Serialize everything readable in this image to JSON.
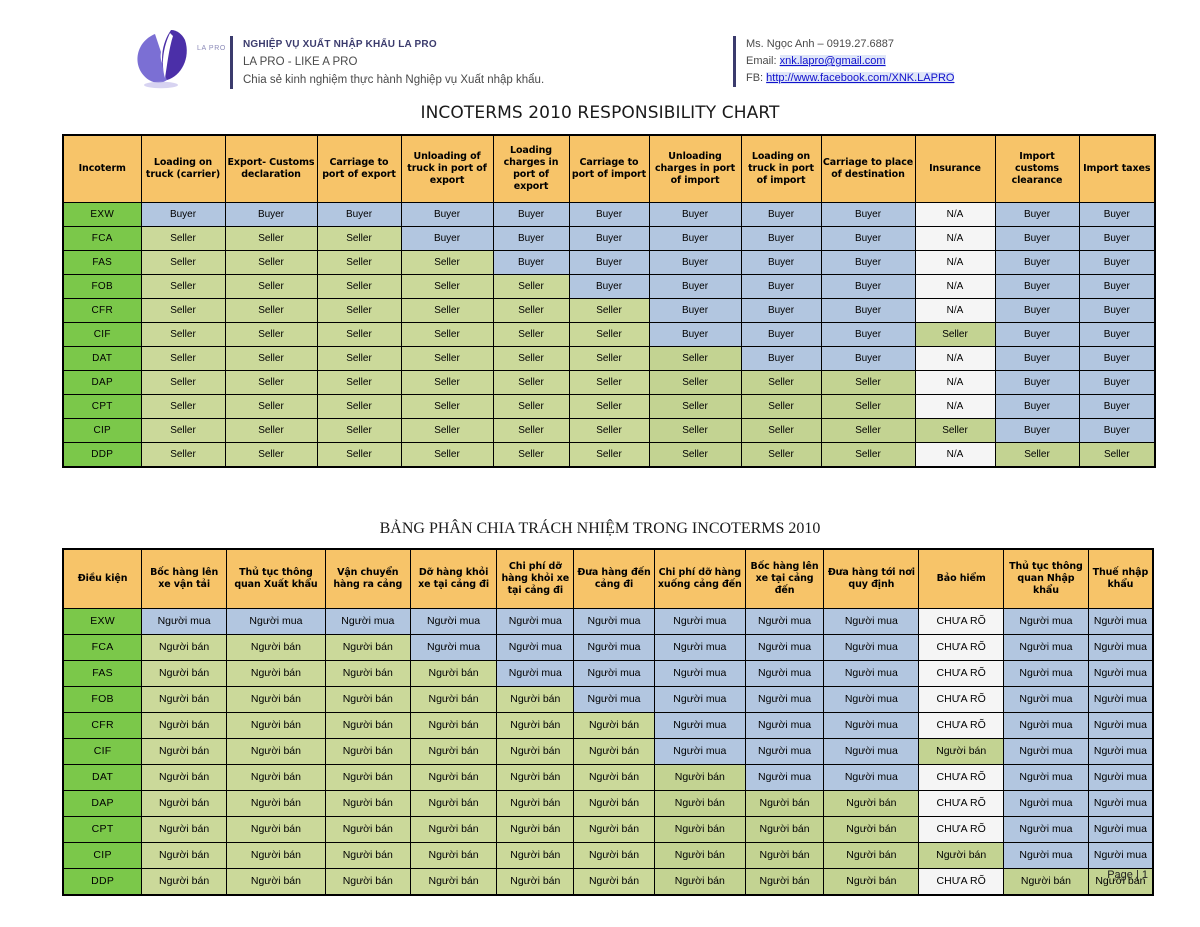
{
  "letterhead": {
    "logo_label": "LA PRO",
    "org_title": "NGHIỆP VỤ XUẤT NHẬP KHẨU LA PRO",
    "tagline": "LA PRO - LIKE A PRO",
    "description": "Chia sẻ kinh nghiệm thực hành Nghiệp vụ Xuất nhập khẩu.",
    "contact_name": "Ms. Ngọc Anh –  0919.27.6887",
    "email_label": "Email: ",
    "email": "xnk.lapro@gmail.com",
    "fb_label": "FB: ",
    "fb_url": "http://www.facebook.com/XNK.LAPRO"
  },
  "table1": {
    "title": "INCOTERMS 2010 RESPONSIBILITY CHART",
    "headers": [
      "Incoterm",
      "Loading on truck (carrier)",
      "Export- Customs declaration",
      "Carriage to port of export",
      "Unloading of truck in port of export",
      "Loading charges in port of export",
      "Carriage to port of import",
      "Unloading charges in port of import",
      "Loading on truck in port of import",
      "Carriage to place of destination",
      "Insurance",
      "Import customs clearance",
      "Import taxes"
    ],
    "values": {
      "buyer": "Buyer",
      "seller": "Seller",
      "na": "N/A"
    },
    "rows": [
      {
        "term": "EXW",
        "cells": [
          "Buyer",
          "Buyer",
          "Buyer",
          "Buyer",
          "Buyer",
          "Buyer",
          "Buyer",
          "Buyer",
          "Buyer",
          "N/A",
          "Buyer",
          "Buyer"
        ]
      },
      {
        "term": "FCA",
        "cells": [
          "Seller",
          "Seller",
          "Seller",
          "Buyer",
          "Buyer",
          "Buyer",
          "Buyer",
          "Buyer",
          "Buyer",
          "N/A",
          "Buyer",
          "Buyer"
        ]
      },
      {
        "term": "FAS",
        "cells": [
          "Seller",
          "Seller",
          "Seller",
          "Seller",
          "Buyer",
          "Buyer",
          "Buyer",
          "Buyer",
          "Buyer",
          "N/A",
          "Buyer",
          "Buyer"
        ]
      },
      {
        "term": "FOB",
        "cells": [
          "Seller",
          "Seller",
          "Seller",
          "Seller",
          "Seller",
          "Buyer",
          "Buyer",
          "Buyer",
          "Buyer",
          "N/A",
          "Buyer",
          "Buyer"
        ]
      },
      {
        "term": "CFR",
        "cells": [
          "Seller",
          "Seller",
          "Seller",
          "Seller",
          "Seller",
          "Seller",
          "Buyer",
          "Buyer",
          "Buyer",
          "N/A",
          "Buyer",
          "Buyer"
        ]
      },
      {
        "term": "CIF",
        "cells": [
          "Seller",
          "Seller",
          "Seller",
          "Seller",
          "Seller",
          "Seller",
          "Buyer",
          "Buyer",
          "Buyer",
          "Seller",
          "Buyer",
          "Buyer"
        ]
      },
      {
        "term": "DAT",
        "cells": [
          "Seller",
          "Seller",
          "Seller",
          "Seller",
          "Seller",
          "Seller",
          "Seller",
          "Buyer",
          "Buyer",
          "N/A",
          "Buyer",
          "Buyer"
        ]
      },
      {
        "term": "DAP",
        "cells": [
          "Seller",
          "Seller",
          "Seller",
          "Seller",
          "Seller",
          "Seller",
          "Seller",
          "Seller",
          "Seller",
          "N/A",
          "Buyer",
          "Buyer"
        ]
      },
      {
        "term": "CPT",
        "cells": [
          "Seller",
          "Seller",
          "Seller",
          "Seller",
          "Seller",
          "Seller",
          "Seller",
          "Seller",
          "Seller",
          "N/A",
          "Buyer",
          "Buyer"
        ]
      },
      {
        "term": "CIP",
        "cells": [
          "Seller",
          "Seller",
          "Seller",
          "Seller",
          "Seller",
          "Seller",
          "Seller",
          "Seller",
          "Seller",
          "Seller",
          "Buyer",
          "Buyer"
        ]
      },
      {
        "term": "DDP",
        "cells": [
          "Seller",
          "Seller",
          "Seller",
          "Seller",
          "Seller",
          "Seller",
          "Seller",
          "Seller",
          "Seller",
          "N/A",
          "Seller",
          "Seller"
        ]
      }
    ]
  },
  "table2": {
    "title": "BẢNG PHÂN CHIA TRÁCH NHIỆM TRONG INCOTERMS 2010",
    "headers": [
      "Điều kiện",
      "Bốc hàng lên xe vận tải",
      "Thủ tục thông quan Xuất khẩu",
      "Vận chuyển hàng ra cảng",
      "Dỡ hàng khỏi xe tại cảng đi",
      "Chi phí dỡ hàng khỏi xe tại cảng đi",
      "Đưa hàng đến cảng đi",
      "Chi phí dỡ hàng xuống cảng đến",
      "Bốc hàng lên xe tại cảng đến",
      "Đưa hàng tới nơi quy định",
      "Bảo hiểm",
      "Thủ tục thông quan Nhập khẩu",
      "Thuế nhập khẩu"
    ],
    "values": {
      "buyer": "Người mua",
      "seller": "Người bán",
      "na": "CHƯA RÕ"
    },
    "rows": [
      {
        "term": "EXW",
        "cells": [
          "Người mua",
          "Người mua",
          "Người mua",
          "Người mua",
          "Người mua",
          "Người mua",
          "Người mua",
          "Người mua",
          "Người mua",
          "CHƯA RÕ",
          "Người mua",
          "Người mua"
        ]
      },
      {
        "term": "FCA",
        "cells": [
          "Người bán",
          "Người bán",
          "Người bán",
          "Người mua",
          "Người mua",
          "Người mua",
          "Người mua",
          "Người mua",
          "Người mua",
          "CHƯA RÕ",
          "Người mua",
          "Người mua"
        ]
      },
      {
        "term": "FAS",
        "cells": [
          "Người bán",
          "Người bán",
          "Người bán",
          "Người bán",
          "Người mua",
          "Người mua",
          "Người mua",
          "Người mua",
          "Người mua",
          "CHƯA RÕ",
          "Người mua",
          "Người mua"
        ]
      },
      {
        "term": "FOB",
        "cells": [
          "Người bán",
          "Người bán",
          "Người bán",
          "Người bán",
          "Người bán",
          "Người mua",
          "Người mua",
          "Người mua",
          "Người mua",
          "CHƯA RÕ",
          "Người mua",
          "Người mua"
        ]
      },
      {
        "term": "CFR",
        "cells": [
          "Người bán",
          "Người bán",
          "Người bán",
          "Người bán",
          "Người bán",
          "Người bán",
          "Người mua",
          "Người mua",
          "Người mua",
          "CHƯA RÕ",
          "Người mua",
          "Người mua"
        ]
      },
      {
        "term": "CIF",
        "cells": [
          "Người bán",
          "Người bán",
          "Người bán",
          "Người bán",
          "Người bán",
          "Người bán",
          "Người mua",
          "Người mua",
          "Người mua",
          "Người bán",
          "Người mua",
          "Người mua"
        ]
      },
      {
        "term": "DAT",
        "cells": [
          "Người bán",
          "Người bán",
          "Người bán",
          "Người bán",
          "Người bán",
          "Người bán",
          "Người bán",
          "Người mua",
          "Người mua",
          "CHƯA RÕ",
          "Người mua",
          "Người mua"
        ]
      },
      {
        "term": "DAP",
        "cells": [
          "Người bán",
          "Người bán",
          "Người bán",
          "Người bán",
          "Người bán",
          "Người bán",
          "Người bán",
          "Người bán",
          "Người bán",
          "CHƯA RÕ",
          "Người mua",
          "Người mua"
        ]
      },
      {
        "term": "CPT",
        "cells": [
          "Người bán",
          "Người bán",
          "Người bán",
          "Người bán",
          "Người bán",
          "Người bán",
          "Người bán",
          "Người bán",
          "Người bán",
          "CHƯA RÕ",
          "Người mua",
          "Người mua"
        ]
      },
      {
        "term": "CIP",
        "cells": [
          "Người bán",
          "Người bán",
          "Người bán",
          "Người bán",
          "Người bán",
          "Người bán",
          "Người bán",
          "Người bán",
          "Người bán",
          "Người bán",
          "Người mua",
          "Người mua"
        ]
      },
      {
        "term": "DDP",
        "cells": [
          "Người bán",
          "Người bán",
          "Người bán",
          "Người bán",
          "Người bán",
          "Người bán",
          "Người bán",
          "Người bán",
          "Người bán",
          "CHƯA RÕ",
          "Người bán",
          "Người bán"
        ]
      }
    ]
  },
  "footer": {
    "page_label": "Page | 1"
  },
  "colors": {
    "header_orange": "#f7c469",
    "term_green": "#7bc84a",
    "buyer_blue": "#b2c6e0",
    "seller_green": "#cbd99a",
    "na_white": "#f5f5f5",
    "link_blue": "#1111cc",
    "brand_purple": "#3b3b6d"
  }
}
